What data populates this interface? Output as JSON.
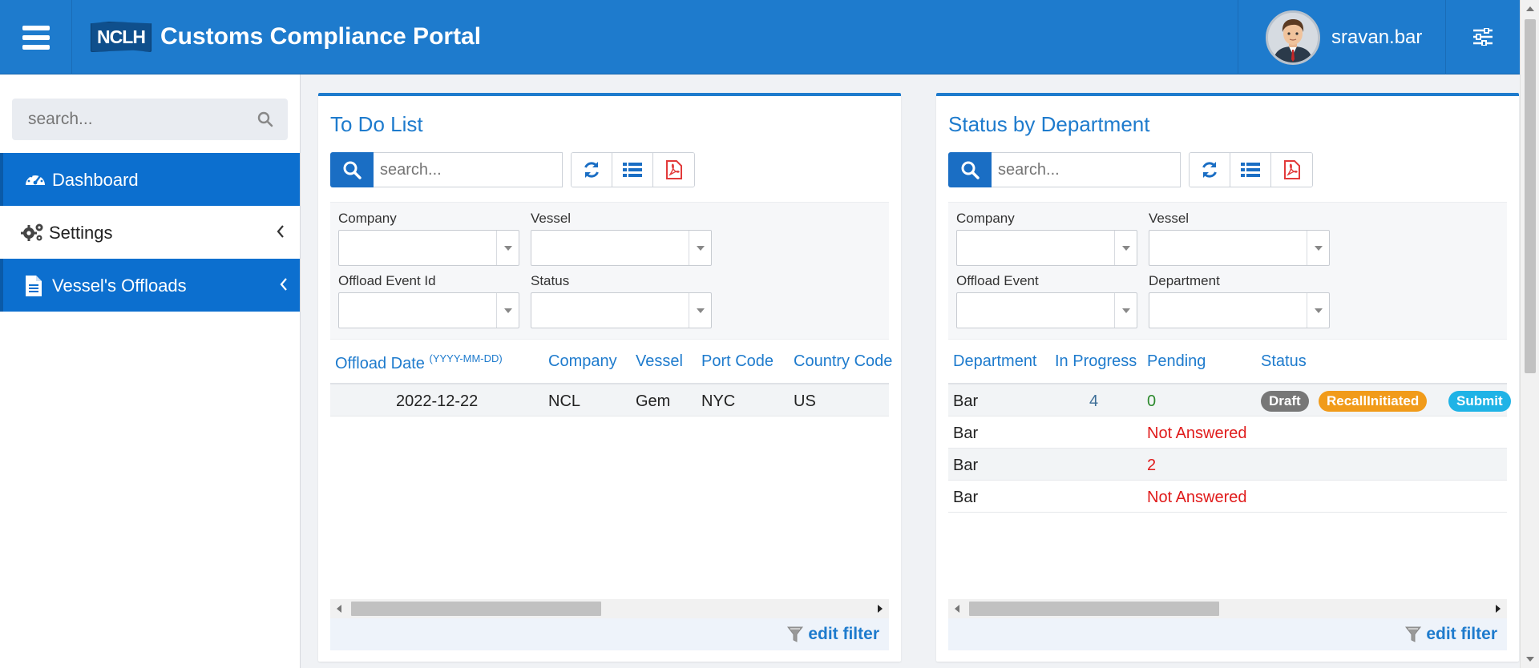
{
  "header": {
    "logo_text": "NCLH",
    "app_title": "Customs Compliance Portal",
    "username": "sravan.bar",
    "colors": {
      "primary": "#1e7bcd",
      "nav_active": "#0c6fcf"
    }
  },
  "sidebar": {
    "search_placeholder": "search...",
    "items": [
      {
        "label": "Dashboard",
        "icon": "dashboard-gauge-icon",
        "active": true,
        "has_chevron": false
      },
      {
        "label": "Settings",
        "icon": "gears-icon",
        "active": false,
        "has_chevron": true
      },
      {
        "label": "Vessel's Offloads",
        "icon": "document-icon",
        "active": true,
        "has_chevron": true
      }
    ]
  },
  "todo": {
    "title": "To Do List",
    "search_placeholder": "search...",
    "toolbar_icons": [
      "refresh-icon",
      "list-icon",
      "pdf-icon"
    ],
    "filters": [
      {
        "label": "Company",
        "value": ""
      },
      {
        "label": "Vessel",
        "value": ""
      },
      {
        "label": "Offload Event Id",
        "value": ""
      },
      {
        "label": "Status",
        "value": ""
      }
    ],
    "columns": [
      "Offload Date",
      "Company",
      "Vessel",
      "Port Code",
      "Country Code"
    ],
    "date_hint": "(YYYY-MM-DD)",
    "rows": [
      {
        "offload_date": "2022-12-22",
        "company": "NCL",
        "vessel": "Gem",
        "port_code": "NYC",
        "country_code": "US"
      }
    ],
    "edit_filter": "edit filter"
  },
  "status_dept": {
    "title": "Status by Department",
    "search_placeholder": "search...",
    "toolbar_icons": [
      "refresh-icon",
      "list-icon",
      "pdf-icon"
    ],
    "filters": [
      {
        "label": "Company",
        "value": ""
      },
      {
        "label": "Vessel",
        "value": ""
      },
      {
        "label": "Offload Event",
        "value": ""
      },
      {
        "label": "Department",
        "value": ""
      }
    ],
    "columns": [
      "Department",
      "In Progress",
      "Pending",
      "Status"
    ],
    "rows": [
      {
        "department": "Bar",
        "in_progress": "4",
        "pending": "0",
        "statuses": [
          "Draft",
          "RecallInitiated",
          "Submit"
        ]
      },
      {
        "department": "Bar",
        "in_progress": "",
        "pending": "Not Answered",
        "statuses": []
      },
      {
        "department": "Bar",
        "in_progress": "",
        "pending": "2",
        "statuses": []
      },
      {
        "department": "Bar",
        "in_progress": "",
        "pending": "Not Answered",
        "statuses": []
      }
    ],
    "status_colors": {
      "Draft": "#777777",
      "RecallInitiated": "#f19b1a",
      "Submit": "#1fb3e6"
    },
    "edit_filter": "edit filter"
  }
}
